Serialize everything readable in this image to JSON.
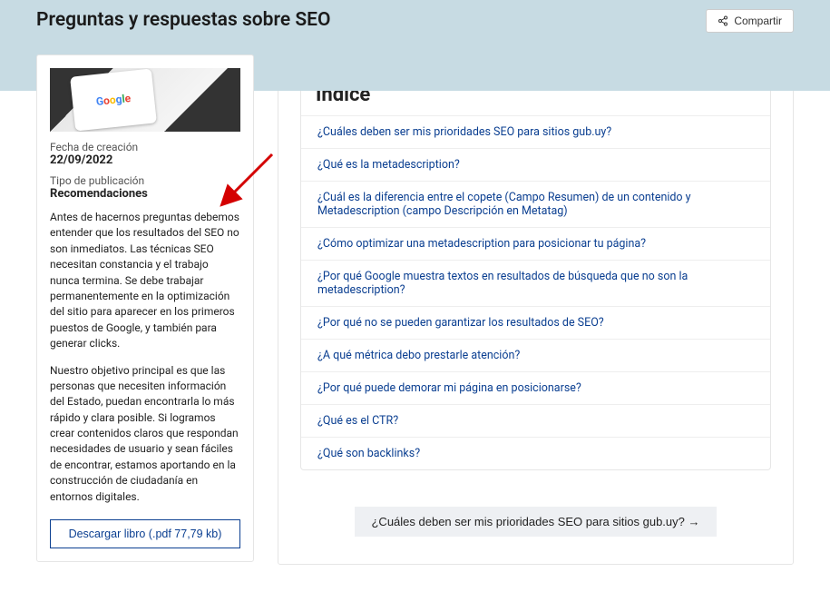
{
  "header": {
    "title": "Preguntas y respuestas sobre SEO",
    "share_label": "Compartir"
  },
  "sidebar": {
    "thumb_logo_letters": [
      "G",
      "o",
      "o",
      "g",
      "l",
      "e"
    ],
    "creation_label": "Fecha de creación",
    "creation_value": "22/09/2022",
    "pubtype_label": "Tipo de publicación",
    "pubtype_value": "Recomendaciones",
    "desc_p1": "Antes de hacernos preguntas debemos entender que los resultados del SEO no son inmediatos. Las técnicas SEO necesitan constancia y el trabajo nunca termina. Se debe trabajar permanentemente en la optimización del sitio para aparecer en los primeros puestos de Google, y también para generar clicks.",
    "desc_p2": "Nuestro objetivo principal es que las personas que necesiten información del Estado, puedan encontrarla lo más rápido y clara posible. Si logramos crear contenidos claros que respondan necesidades de usuario y sean fáciles de encontrar, estamos aportando en la construcción de ciudadanía en entornos digitales.",
    "download_label": "Descargar libro (.pdf 77,79 kb)"
  },
  "index": {
    "title": "Índice",
    "items": [
      "¿Cuáles deben ser mis prioridades SEO para sitios gub.uy?",
      "¿Qué es la metadescription?",
      "¿Cuál es la diferencia entre el copete (Campo Resumen) de un contenido y Metadescription (campo Descripción en Metatag)",
      "¿Cómo optimizar una metadescription para posicionar tu página?",
      "¿Por qué Google muestra textos en resultados de búsqueda que no son la metadescription?",
      "¿Por qué no se pueden garantizar los resultados de SEO?",
      "¿A qué métrica debo prestarle atención?",
      "¿Por qué puede demorar mi página en posicionarse?",
      "¿Qué es el CTR?",
      "¿Qué son backlinks?"
    ]
  },
  "nav_pill": {
    "label": "¿Cuáles deben ser mis prioridades SEO para sitios gub.uy?  →"
  },
  "annotation": {
    "arrow_color": "#d40000"
  }
}
